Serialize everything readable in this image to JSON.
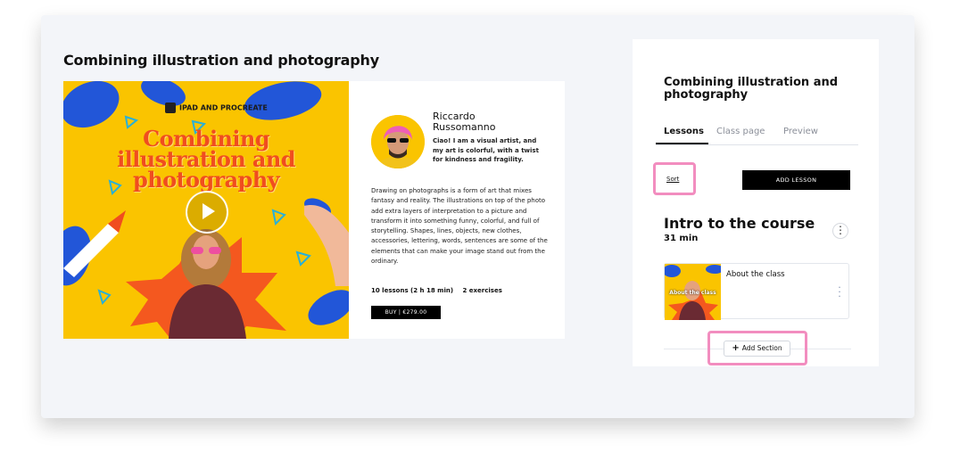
{
  "page": {
    "title": "Combining illustration and photography"
  },
  "preview": {
    "cover": {
      "tag": "IPAD AND PROCREATE",
      "title": "Combining illustration and photography",
      "play_icon": "play-icon"
    },
    "author": {
      "name": "Riccardo Russomanno",
      "bio": "Ciao! I am a visual artist, and my art is colorful, with a twist for kindness and fragility."
    },
    "description": "Drawing on photographs is a form of art that mixes fantasy and reality. The illustrations on top of the photo add extra layers of interpretation to a picture and transform it into something funny, colorful, and full of storytelling. Shapes, lines, objects, new clothes, accessories, lettering, words, sentences are some of the elements that can make your image stand out from the ordinary.",
    "stats": {
      "lessons": "10 lessons (2 h 18 min)",
      "exercises": "2 exercises"
    },
    "buy_label": "BUY | €279.00"
  },
  "panel": {
    "title": "Combining illustration and photography",
    "tabs": [
      {
        "label": "Lessons",
        "active": true
      },
      {
        "label": "Class page",
        "active": false
      },
      {
        "label": "Preview",
        "active": false
      }
    ],
    "sort_label": "Sort",
    "add_lesson_label": "ADD LESSON",
    "section": {
      "title": "Intro to the course",
      "duration": "31 min",
      "lessons": [
        {
          "title": "About the class",
          "thumb_label": "About the class"
        }
      ]
    },
    "add_section_label": "Add Section"
  },
  "colors": {
    "accent_yellow": "#fac400",
    "cover_title_orange": "#f04d1f",
    "highlight_pink": "#f28dbf",
    "button_black": "#000000"
  }
}
